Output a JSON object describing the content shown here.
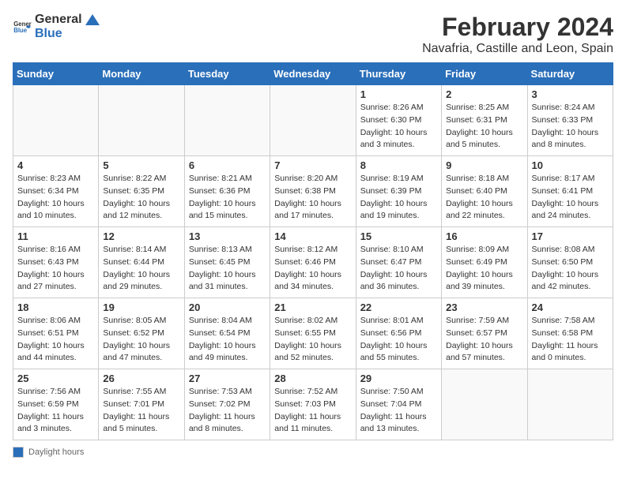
{
  "logo": {
    "general": "General",
    "blue": "Blue"
  },
  "title": "February 2024",
  "subtitle": "Navafria, Castille and Leon, Spain",
  "days_of_week": [
    "Sunday",
    "Monday",
    "Tuesday",
    "Wednesday",
    "Thursday",
    "Friday",
    "Saturday"
  ],
  "weeks": [
    [
      {
        "day": "",
        "info": ""
      },
      {
        "day": "",
        "info": ""
      },
      {
        "day": "",
        "info": ""
      },
      {
        "day": "",
        "info": ""
      },
      {
        "day": "1",
        "info": "Sunrise: 8:26 AM\nSunset: 6:30 PM\nDaylight: 10 hours and 3 minutes."
      },
      {
        "day": "2",
        "info": "Sunrise: 8:25 AM\nSunset: 6:31 PM\nDaylight: 10 hours and 5 minutes."
      },
      {
        "day": "3",
        "info": "Sunrise: 8:24 AM\nSunset: 6:33 PM\nDaylight: 10 hours and 8 minutes."
      }
    ],
    [
      {
        "day": "4",
        "info": "Sunrise: 8:23 AM\nSunset: 6:34 PM\nDaylight: 10 hours and 10 minutes."
      },
      {
        "day": "5",
        "info": "Sunrise: 8:22 AM\nSunset: 6:35 PM\nDaylight: 10 hours and 12 minutes."
      },
      {
        "day": "6",
        "info": "Sunrise: 8:21 AM\nSunset: 6:36 PM\nDaylight: 10 hours and 15 minutes."
      },
      {
        "day": "7",
        "info": "Sunrise: 8:20 AM\nSunset: 6:38 PM\nDaylight: 10 hours and 17 minutes."
      },
      {
        "day": "8",
        "info": "Sunrise: 8:19 AM\nSunset: 6:39 PM\nDaylight: 10 hours and 19 minutes."
      },
      {
        "day": "9",
        "info": "Sunrise: 8:18 AM\nSunset: 6:40 PM\nDaylight: 10 hours and 22 minutes."
      },
      {
        "day": "10",
        "info": "Sunrise: 8:17 AM\nSunset: 6:41 PM\nDaylight: 10 hours and 24 minutes."
      }
    ],
    [
      {
        "day": "11",
        "info": "Sunrise: 8:16 AM\nSunset: 6:43 PM\nDaylight: 10 hours and 27 minutes."
      },
      {
        "day": "12",
        "info": "Sunrise: 8:14 AM\nSunset: 6:44 PM\nDaylight: 10 hours and 29 minutes."
      },
      {
        "day": "13",
        "info": "Sunrise: 8:13 AM\nSunset: 6:45 PM\nDaylight: 10 hours and 31 minutes."
      },
      {
        "day": "14",
        "info": "Sunrise: 8:12 AM\nSunset: 6:46 PM\nDaylight: 10 hours and 34 minutes."
      },
      {
        "day": "15",
        "info": "Sunrise: 8:10 AM\nSunset: 6:47 PM\nDaylight: 10 hours and 36 minutes."
      },
      {
        "day": "16",
        "info": "Sunrise: 8:09 AM\nSunset: 6:49 PM\nDaylight: 10 hours and 39 minutes."
      },
      {
        "day": "17",
        "info": "Sunrise: 8:08 AM\nSunset: 6:50 PM\nDaylight: 10 hours and 42 minutes."
      }
    ],
    [
      {
        "day": "18",
        "info": "Sunrise: 8:06 AM\nSunset: 6:51 PM\nDaylight: 10 hours and 44 minutes."
      },
      {
        "day": "19",
        "info": "Sunrise: 8:05 AM\nSunset: 6:52 PM\nDaylight: 10 hours and 47 minutes."
      },
      {
        "day": "20",
        "info": "Sunrise: 8:04 AM\nSunset: 6:54 PM\nDaylight: 10 hours and 49 minutes."
      },
      {
        "day": "21",
        "info": "Sunrise: 8:02 AM\nSunset: 6:55 PM\nDaylight: 10 hours and 52 minutes."
      },
      {
        "day": "22",
        "info": "Sunrise: 8:01 AM\nSunset: 6:56 PM\nDaylight: 10 hours and 55 minutes."
      },
      {
        "day": "23",
        "info": "Sunrise: 7:59 AM\nSunset: 6:57 PM\nDaylight: 10 hours and 57 minutes."
      },
      {
        "day": "24",
        "info": "Sunrise: 7:58 AM\nSunset: 6:58 PM\nDaylight: 11 hours and 0 minutes."
      }
    ],
    [
      {
        "day": "25",
        "info": "Sunrise: 7:56 AM\nSunset: 6:59 PM\nDaylight: 11 hours and 3 minutes."
      },
      {
        "day": "26",
        "info": "Sunrise: 7:55 AM\nSunset: 7:01 PM\nDaylight: 11 hours and 5 minutes."
      },
      {
        "day": "27",
        "info": "Sunrise: 7:53 AM\nSunset: 7:02 PM\nDaylight: 11 hours and 8 minutes."
      },
      {
        "day": "28",
        "info": "Sunrise: 7:52 AM\nSunset: 7:03 PM\nDaylight: 11 hours and 11 minutes."
      },
      {
        "day": "29",
        "info": "Sunrise: 7:50 AM\nSunset: 7:04 PM\nDaylight: 11 hours and 13 minutes."
      },
      {
        "day": "",
        "info": ""
      },
      {
        "day": "",
        "info": ""
      }
    ]
  ],
  "footer": {
    "legend_label": "Daylight hours"
  }
}
